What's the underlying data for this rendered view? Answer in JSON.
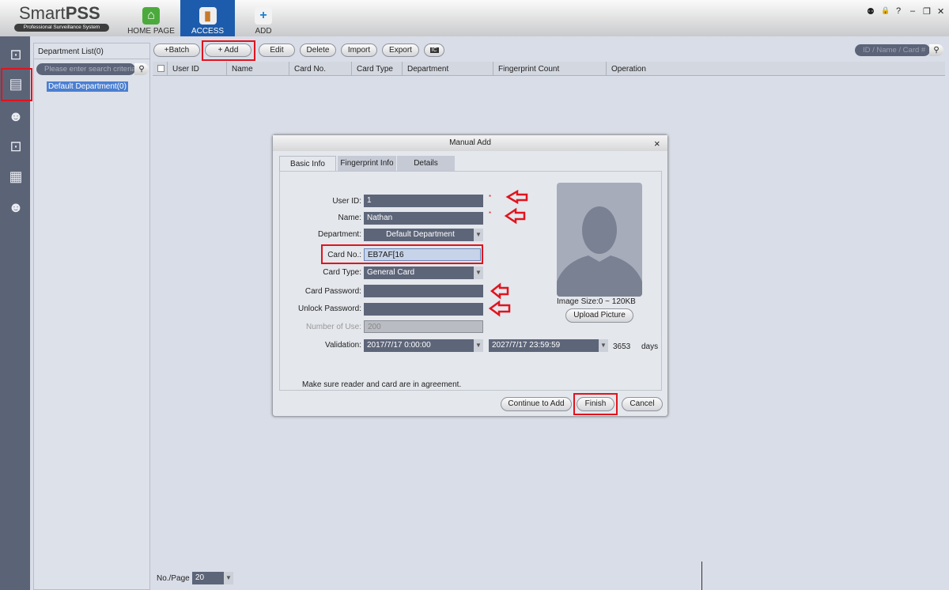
{
  "app": {
    "logo_main": "Smart",
    "logo_bold": "PSS",
    "logo_sub": "Professional Surveillance System"
  },
  "nav_tabs": [
    {
      "label": "HOME PAGE",
      "icon": "home-icon"
    },
    {
      "label": "ACCESS",
      "icon": "door-icon",
      "active": true
    },
    {
      "label": "ADD",
      "icon": "plus-icon"
    }
  ],
  "window_controls": [
    "user-icon",
    "lock-icon",
    "help-icon",
    "minimize-icon",
    "restore-icon",
    "close-icon"
  ],
  "window_glyphs": [
    "⚉",
    "🔒",
    "?",
    "–",
    "❐",
    "✕"
  ],
  "help": "?",
  "sidebar_icons": [
    "door-user-icon",
    "card-user-icon",
    "user-settings-icon",
    "door-bell-icon",
    "report-search-icon",
    "user-clock-icon"
  ],
  "department": {
    "title": "Department List(0)",
    "search_placeholder": "Please enter search criteria",
    "items": [
      "Default Department(0)"
    ]
  },
  "toolbar": {
    "batch": "+Batch",
    "add": "+ Add",
    "edit": "Edit",
    "delete": "Delete",
    "import": "Import",
    "export": "Export",
    "ic": "IC",
    "search_placeholder": "ID / Name / Card #"
  },
  "table": {
    "columns": [
      "User ID",
      "Name",
      "Card No.",
      "Card Type",
      "Department",
      "Fingerprint Count",
      "Operation"
    ]
  },
  "pagination": {
    "label": "No./Page",
    "value": "20"
  },
  "dialog": {
    "title": "Manual Add",
    "close": "×",
    "tabs": [
      "Basic Info",
      "Fingerprint Info",
      "Details"
    ],
    "fields": {
      "user_id": {
        "label": "User ID:",
        "value": "1"
      },
      "name": {
        "label": "Name:",
        "value": "Nathan"
      },
      "department": {
        "label": "Department:",
        "value": "Default Department"
      },
      "card_no": {
        "label": "Card No.:",
        "value": "EB7AF[16"
      },
      "card_type": {
        "label": "Card Type:",
        "value": "General Card"
      },
      "card_password": {
        "label": "Card Password:",
        "value": ""
      },
      "unlock_password": {
        "label": "Unlock Password:",
        "value": ""
      },
      "number_of_use": {
        "label": "Number of Use:",
        "value": "200"
      },
      "validation": {
        "label": "Validation:",
        "start": "2017/7/17 0:00:00",
        "end": "2027/7/17 23:59:59",
        "days": "3653",
        "days_unit": "days"
      }
    },
    "required_mark": "*",
    "image_size": "Image Size:0 ~ 120KB",
    "upload": "Upload Picture",
    "note": "Make sure reader and card are in agreement.",
    "buttons": {
      "continue": "Continue to Add",
      "finish": "Finish",
      "cancel": "Cancel"
    }
  },
  "colors": {
    "accent": "#1d5cac",
    "field": "#5d6579",
    "annotation": "#e0141e"
  }
}
